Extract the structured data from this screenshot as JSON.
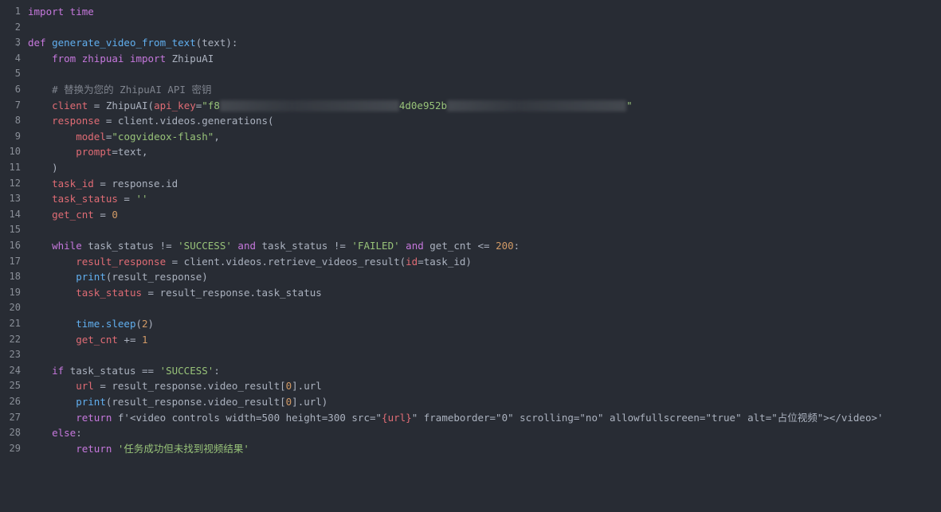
{
  "editor": {
    "lines": [
      {
        "n": "1",
        "fold": "",
        "parts": [
          {
            "t": "import time",
            "c": "kw"
          }
        ]
      },
      {
        "n": "2",
        "fold": "",
        "parts": []
      },
      {
        "n": "3",
        "fold": "v",
        "parts": [
          {
            "t": "def ",
            "c": "kw"
          },
          {
            "t": "generate_video_from_text",
            "c": "fn"
          },
          {
            "t": "(text):",
            "c": "plain"
          }
        ]
      },
      {
        "n": "4",
        "fold": "",
        "parts": [
          {
            "t": "    ",
            "c": "plain"
          },
          {
            "t": "from zhipuai import ",
            "c": "kw"
          },
          {
            "t": "ZhipuAI",
            "c": "plain"
          }
        ]
      },
      {
        "n": "5",
        "fold": "",
        "parts": []
      },
      {
        "n": "6",
        "fold": "",
        "parts": [
          {
            "t": "    # 替换为您的 ZhipuAI API 密钥",
            "c": "cmt"
          }
        ]
      },
      {
        "n": "7",
        "fold": "",
        "parts": [
          {
            "t": "    ",
            "c": "plain"
          },
          {
            "t": "client",
            "c": "var"
          },
          {
            "t": " = ZhipuAI(",
            "c": "plain"
          },
          {
            "t": "api_key",
            "c": "var"
          },
          {
            "t": "=",
            "c": "plain"
          },
          {
            "t": "\"f8",
            "c": "str"
          },
          {
            "t": "BLUR",
            "c": "blur"
          },
          {
            "t": "4d0e952b",
            "c": "str"
          },
          {
            "t": "BLUR",
            "c": "blur"
          },
          {
            "t": "\"",
            "c": "str"
          }
        ]
      },
      {
        "n": "8",
        "fold": "",
        "parts": [
          {
            "t": "    ",
            "c": "plain"
          },
          {
            "t": "response",
            "c": "var"
          },
          {
            "t": " = client.videos.generations(",
            "c": "plain"
          }
        ]
      },
      {
        "n": "9",
        "fold": "",
        "parts": [
          {
            "t": "        ",
            "c": "plain"
          },
          {
            "t": "model",
            "c": "var"
          },
          {
            "t": "=",
            "c": "plain"
          },
          {
            "t": "\"cogvideox-flash\"",
            "c": "str"
          },
          {
            "t": ",",
            "c": "plain"
          }
        ]
      },
      {
        "n": "10",
        "fold": "",
        "parts": [
          {
            "t": "        ",
            "c": "plain"
          },
          {
            "t": "prompt",
            "c": "var"
          },
          {
            "t": "=text,",
            "c": "plain"
          }
        ]
      },
      {
        "n": "11",
        "fold": "",
        "parts": [
          {
            "t": "    )",
            "c": "plain"
          }
        ]
      },
      {
        "n": "12",
        "fold": "",
        "parts": [
          {
            "t": "    ",
            "c": "plain"
          },
          {
            "t": "task_id",
            "c": "var"
          },
          {
            "t": " = response.id",
            "c": "plain"
          }
        ]
      },
      {
        "n": "13",
        "fold": "",
        "parts": [
          {
            "t": "    ",
            "c": "plain"
          },
          {
            "t": "task_status",
            "c": "var"
          },
          {
            "t": " = ",
            "c": "plain"
          },
          {
            "t": "''",
            "c": "str"
          }
        ]
      },
      {
        "n": "14",
        "fold": "",
        "parts": [
          {
            "t": "    ",
            "c": "plain"
          },
          {
            "t": "get_cnt",
            "c": "var"
          },
          {
            "t": " = ",
            "c": "plain"
          },
          {
            "t": "0",
            "c": "num"
          }
        ]
      },
      {
        "n": "15",
        "fold": "",
        "parts": []
      },
      {
        "n": "16",
        "fold": "v",
        "parts": [
          {
            "t": "    ",
            "c": "plain"
          },
          {
            "t": "while ",
            "c": "kw"
          },
          {
            "t": "task_status != ",
            "c": "plain"
          },
          {
            "t": "'SUCCESS'",
            "c": "str"
          },
          {
            "t": " and ",
            "c": "kw"
          },
          {
            "t": "task_status != ",
            "c": "plain"
          },
          {
            "t": "'FAILED'",
            "c": "str"
          },
          {
            "t": " and ",
            "c": "kw"
          },
          {
            "t": "get_cnt <= ",
            "c": "plain"
          },
          {
            "t": "200",
            "c": "num"
          },
          {
            "t": ":",
            "c": "plain"
          }
        ]
      },
      {
        "n": "17",
        "fold": "",
        "parts": [
          {
            "t": "        ",
            "c": "plain"
          },
          {
            "t": "result_response",
            "c": "var"
          },
          {
            "t": " = client.videos.retrieve_videos_result(",
            "c": "plain"
          },
          {
            "t": "id",
            "c": "var"
          },
          {
            "t": "=task_id)",
            "c": "plain"
          }
        ]
      },
      {
        "n": "18",
        "fold": "",
        "parts": [
          {
            "t": "        ",
            "c": "plain"
          },
          {
            "t": "print",
            "c": "fn"
          },
          {
            "t": "(result_response)",
            "c": "plain"
          }
        ]
      },
      {
        "n": "19",
        "fold": "",
        "parts": [
          {
            "t": "        ",
            "c": "plain"
          },
          {
            "t": "task_status",
            "c": "var"
          },
          {
            "t": " = result_response.task_status",
            "c": "plain"
          }
        ]
      },
      {
        "n": "20",
        "fold": "",
        "parts": []
      },
      {
        "n": "21",
        "fold": "",
        "parts": [
          {
            "t": "        ",
            "c": "plain"
          },
          {
            "t": "time.sleep",
            "c": "fn"
          },
          {
            "t": "(",
            "c": "plain"
          },
          {
            "t": "2",
            "c": "num"
          },
          {
            "t": ")",
            "c": "plain"
          }
        ]
      },
      {
        "n": "22",
        "fold": "",
        "parts": [
          {
            "t": "        ",
            "c": "plain"
          },
          {
            "t": "get_cnt",
            "c": "var"
          },
          {
            "t": " += ",
            "c": "plain"
          },
          {
            "t": "1",
            "c": "num"
          }
        ]
      },
      {
        "n": "23",
        "fold": "",
        "parts": []
      },
      {
        "n": "24",
        "fold": "v",
        "parts": [
          {
            "t": "    ",
            "c": "plain"
          },
          {
            "t": "if ",
            "c": "kw"
          },
          {
            "t": "task_status == ",
            "c": "plain"
          },
          {
            "t": "'SUCCESS'",
            "c": "str"
          },
          {
            "t": ":",
            "c": "plain"
          }
        ]
      },
      {
        "n": "25",
        "fold": "",
        "parts": [
          {
            "t": "        ",
            "c": "plain"
          },
          {
            "t": "url",
            "c": "var"
          },
          {
            "t": " = result_response.video_result[",
            "c": "plain"
          },
          {
            "t": "0",
            "c": "num"
          },
          {
            "t": "].url",
            "c": "plain"
          }
        ]
      },
      {
        "n": "26",
        "fold": "",
        "parts": [
          {
            "t": "        ",
            "c": "plain"
          },
          {
            "t": "print",
            "c": "fn"
          },
          {
            "t": "(result_response.video_result[",
            "c": "plain"
          },
          {
            "t": "0",
            "c": "num"
          },
          {
            "t": "].url)",
            "c": "plain"
          }
        ]
      },
      {
        "n": "27",
        "fold": "",
        "parts": [
          {
            "t": "        ",
            "c": "plain"
          },
          {
            "t": "return ",
            "c": "kw"
          },
          {
            "t": "f'<video controls width=500 height=300 src=\"",
            "c": "plain"
          },
          {
            "t": "{url}",
            "c": "var"
          },
          {
            "t": "\" frameborder=\"0\" scrolling=\"no\" allowfullscreen=\"true\" alt=\"占位视频\"></video>'",
            "c": "plain"
          }
        ]
      },
      {
        "n": "28",
        "fold": "v",
        "parts": [
          {
            "t": "    ",
            "c": "plain"
          },
          {
            "t": "else",
            "c": "kw"
          },
          {
            "t": ":",
            "c": "plain"
          }
        ]
      },
      {
        "n": "29",
        "fold": "",
        "parts": [
          {
            "t": "        ",
            "c": "plain"
          },
          {
            "t": "return ",
            "c": "kw"
          },
          {
            "t": "'任务成功但未找到视频结果'",
            "c": "str"
          }
        ]
      }
    ]
  }
}
